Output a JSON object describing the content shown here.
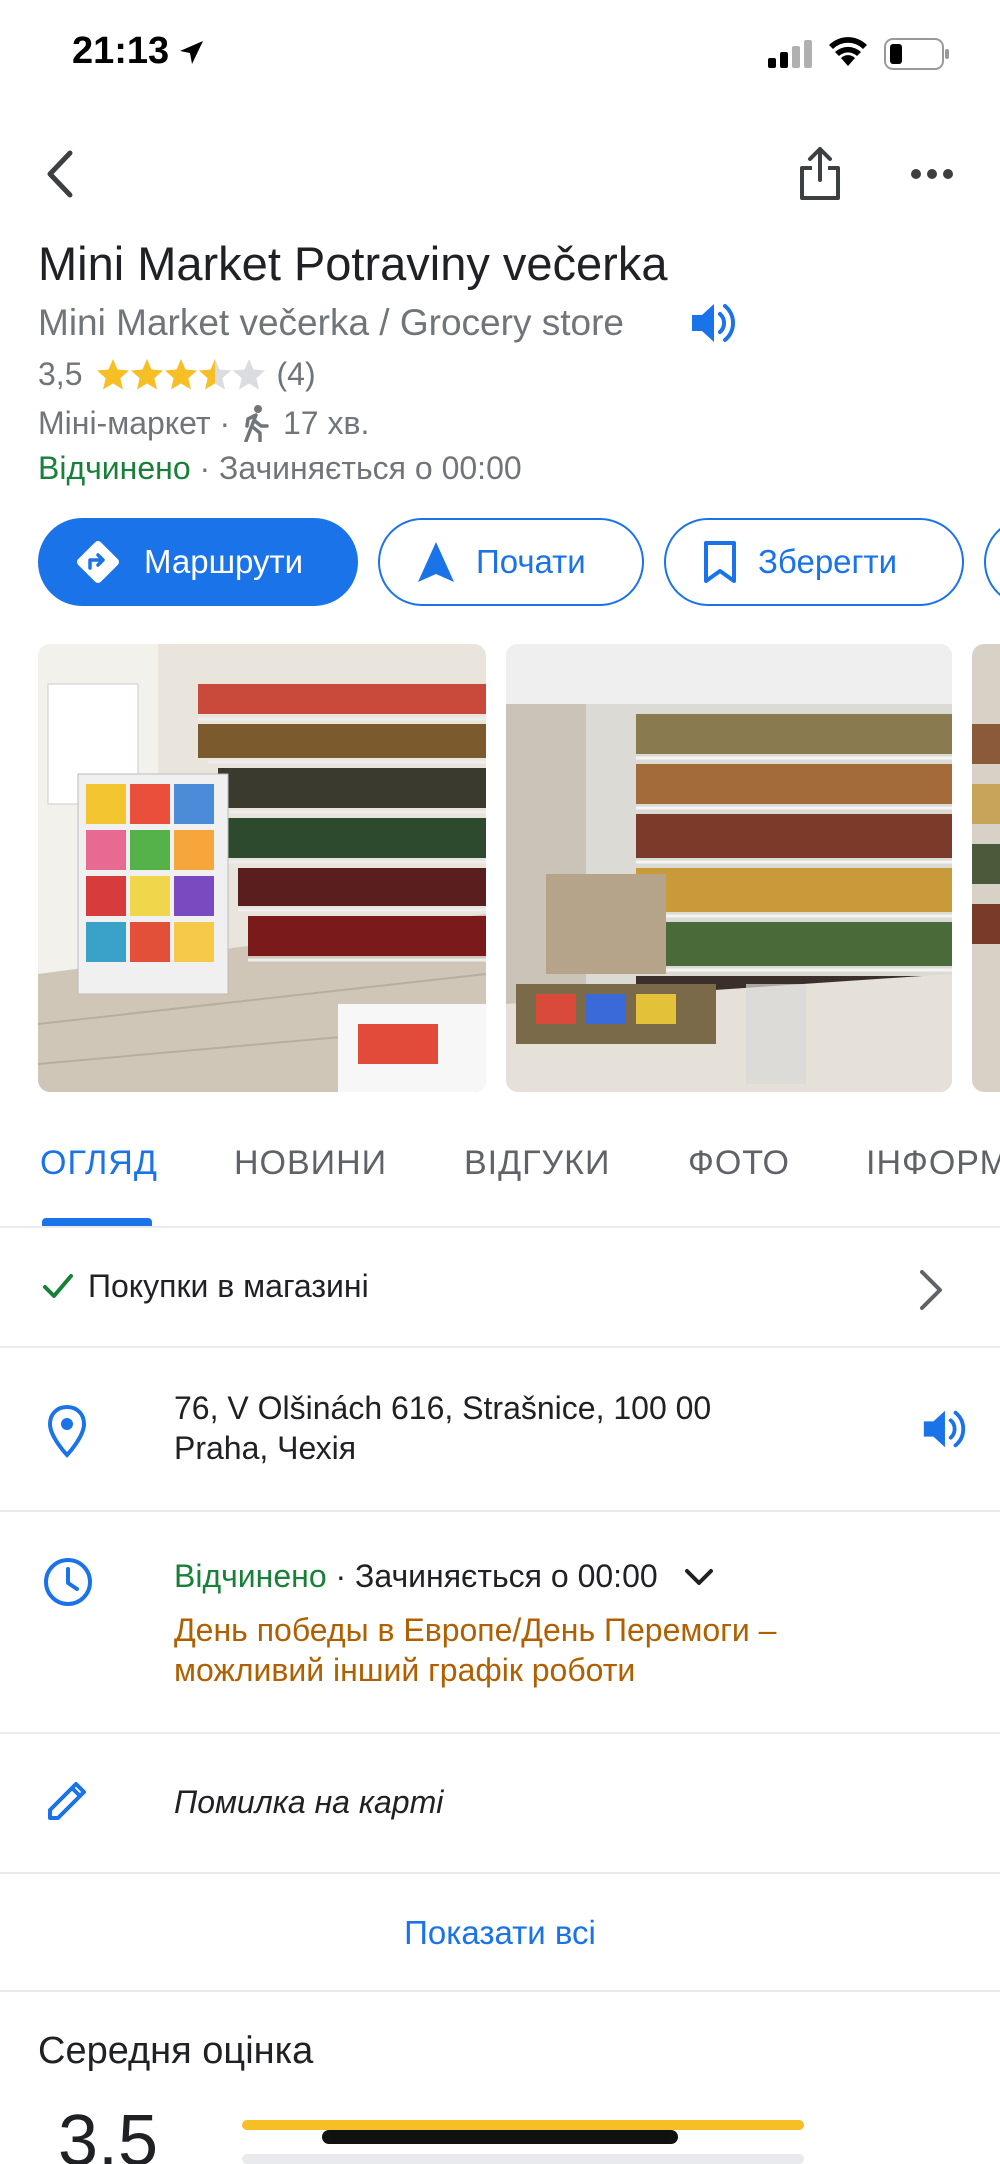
{
  "status_bar": {
    "time": "21:13"
  },
  "place": {
    "title": "Mini Market Potraviny večerka",
    "subtitle": "Mini Market večerka / Grocery store",
    "rating": "3,5",
    "rating_value": 3.5,
    "review_count": "(4)",
    "category": "Міні-маркет",
    "category_sep": " · ",
    "walk_time": "17 хв.",
    "open_status": "Відчинено",
    "open_sep": " · ",
    "closes": "Зачиняється о 00:00"
  },
  "actions": {
    "directions": "Маршрути",
    "start": "Почати",
    "save": "Зберегти"
  },
  "tabs": [
    "ОГЛЯД",
    "НОВИНИ",
    "ВІДГУКИ",
    "ФОТО",
    "ІНФОРМ"
  ],
  "overview": {
    "shopping": "Покупки в магазині",
    "address_line1": "76, V Olšinách 616, Strašnice, 100 00",
    "address_line2": "Praha, Чехія",
    "hours_open": "Відчинено",
    "hours_sep": " · ",
    "hours_closes": "Зачиняється о 00:00",
    "holiday_notice_line1": "День победы в Европе/День Перемоги –",
    "holiday_notice_line2": "можливий інший графік роботи",
    "suggest_edit": "Помилка на карті",
    "show_all": "Показати всі"
  },
  "average_rating": {
    "title": "Середня оцінка",
    "score": "3.5",
    "bar_fill_fraction": 1.0
  },
  "colors": {
    "accent": "#1a73e8",
    "open_green": "#188038",
    "notice_orange": "#b06000",
    "star": "#f6bf26"
  }
}
